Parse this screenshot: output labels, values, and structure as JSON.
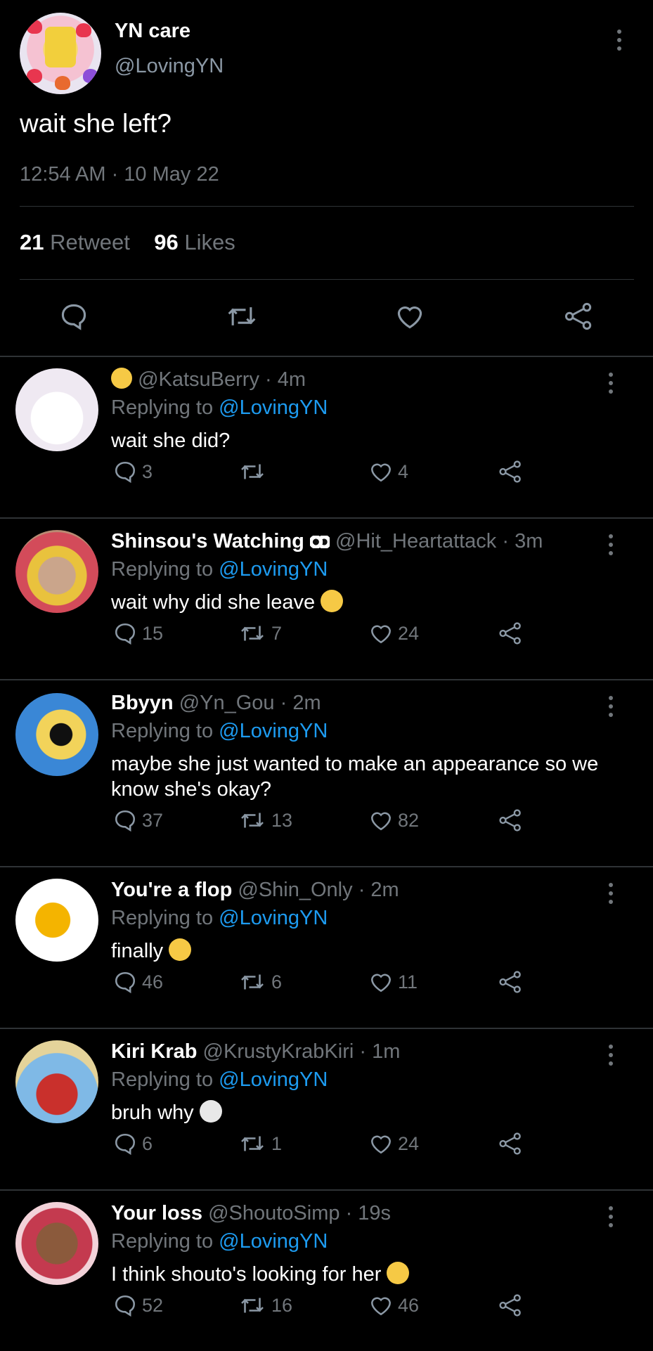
{
  "main_tweet": {
    "name": "YN care",
    "handle": "@LovingYN",
    "text": "wait she left?",
    "timestamp": "12:54 AM · 10 May 22",
    "retweets_count": "21",
    "retweets_label": "Retweet",
    "likes_count": "96",
    "likes_label": "Likes"
  },
  "replies": [
    {
      "name": "",
      "handle": "@KatsuBerry",
      "time": "· 4m",
      "replying_label": "Replying to",
      "replying_to": "@LovingYN",
      "text": "wait she did?",
      "replies": "3",
      "retweets": "",
      "likes": "4",
      "emoji_after_text": ""
    },
    {
      "name": "Shinsou's Watching",
      "handle": "@Hit_Heartattack",
      "time": "· 3m",
      "replying_label": "Replying to",
      "replying_to": "@LovingYN",
      "text": "wait why did she leave",
      "replies": "15",
      "retweets": "7",
      "likes": "24",
      "emoji_after_text": "frowning-face-emoji"
    },
    {
      "name": "Bbyyn",
      "handle": "@Yn_Gou",
      "time": "· 2m",
      "replying_label": "Replying to",
      "replying_to": "@LovingYN",
      "text": "maybe she just wanted to make an appearance so we know she's okay?",
      "replies": "37",
      "retweets": "13",
      "likes": "82",
      "emoji_after_text": ""
    },
    {
      "name": "You're a flop",
      "handle": "@Shin_Only",
      "time": "· 2m",
      "replying_label": "Replying to",
      "replying_to": "@LovingYN",
      "text": "finally",
      "replies": "46",
      "retweets": "6",
      "likes": "11",
      "emoji_after_text": "eye-roll-emoji"
    },
    {
      "name": "Kiri Krab",
      "handle": "@KrustyKrabKiri",
      "time": "· 1m",
      "replying_label": "Replying to",
      "replying_to": "@LovingYN",
      "text": "bruh why",
      "replies": "6",
      "retweets": "1",
      "likes": "24",
      "emoji_after_text": "skull-emoji"
    },
    {
      "name": "Your loss",
      "handle": "@ShoutoSimp",
      "time": "· 19s",
      "replying_label": "Replying to",
      "replying_to": "@LovingYN",
      "text": "I think shouto's looking for her",
      "replies": "52",
      "retweets": "16",
      "likes": "46",
      "emoji_after_text": "frowning-face-emoji"
    }
  ],
  "colors": {
    "background": "#000000",
    "link": "#1d9bf0",
    "muted": "#71767b",
    "divider": "#2f3336"
  },
  "icons": [
    "reply-icon",
    "retweet-icon",
    "like-icon",
    "share-icon",
    "more-options-icon"
  ]
}
